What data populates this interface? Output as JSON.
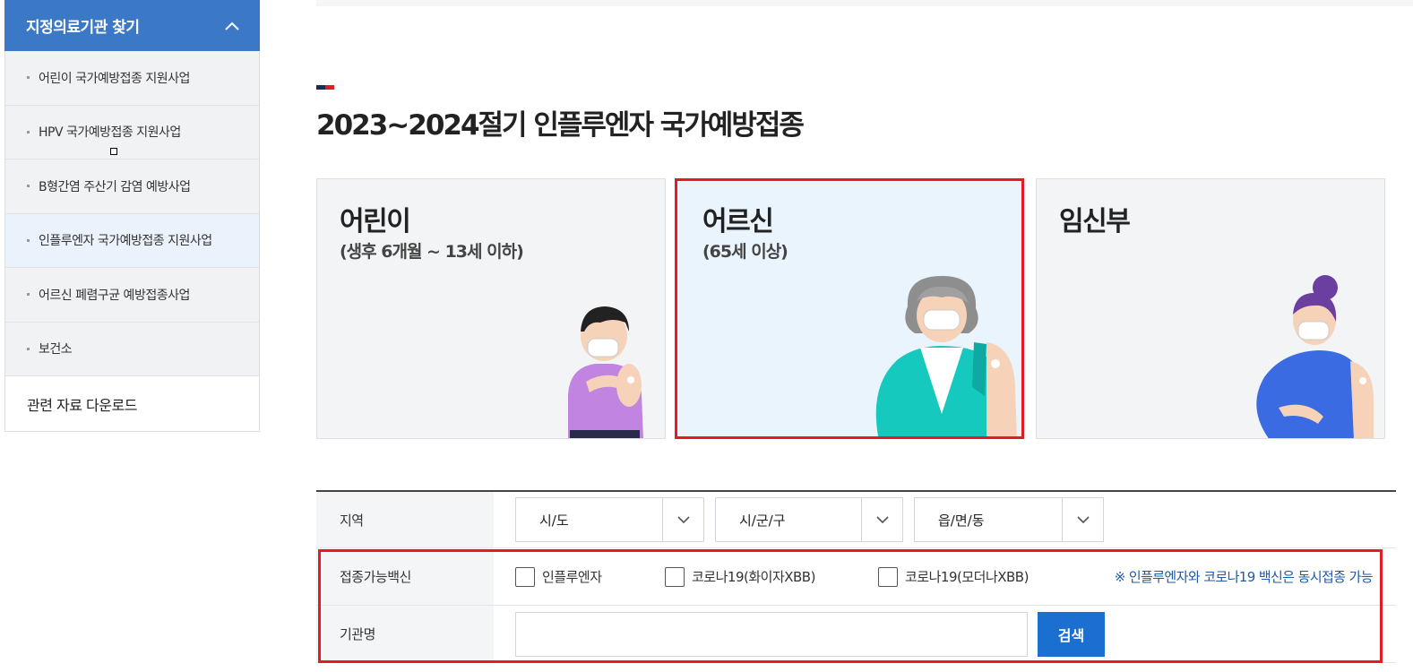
{
  "sidebar": {
    "header": "지정의료기관 찾기",
    "items": [
      {
        "label": "어린이 국가예방접종 지원사업"
      },
      {
        "label": "HPV 국가예방접종 지원사업"
      },
      {
        "label": "B형간염 주산기 감염 예방사업"
      },
      {
        "label": "인플루엔자 국가예방접종 지원사업"
      },
      {
        "label": "어르신 폐렴구균 예방접종사업"
      },
      {
        "label": "보건소"
      }
    ],
    "footer": "관련 자료 다운로드"
  },
  "page": {
    "title": "2023~2024절기 인플루엔자 국가예방접종",
    "title_mark_colors": [
      "#1a2b55",
      "#e21b24"
    ]
  },
  "cards": [
    {
      "title": "어린이",
      "subtitle": "(생후 6개월 ~ 13세 이하)",
      "selected": false
    },
    {
      "title": "어르신",
      "subtitle": "(65세 이상)",
      "selected": true
    },
    {
      "title": "임신부",
      "subtitle": "",
      "selected": false
    }
  ],
  "form": {
    "region_label": "지역",
    "region_selects": [
      "시/도",
      "시/군/구",
      "읍/면/동"
    ],
    "vaccine_label": "접종가능백신",
    "vaccines": [
      "인플루엔자",
      "코로나19(화이자XBB)",
      "코로나19(모더나XBB)"
    ],
    "vaccine_note": "※ 인플루엔자와 코로나19 백신은 동시접종 가능",
    "name_label": "기관명",
    "name_value": "",
    "search_button": "검색"
  },
  "colors": {
    "sidebar_header": "#3b79c7",
    "highlight": "#e21b24",
    "search_button": "#1a6fd1",
    "note_text": "#1f5ba8"
  }
}
